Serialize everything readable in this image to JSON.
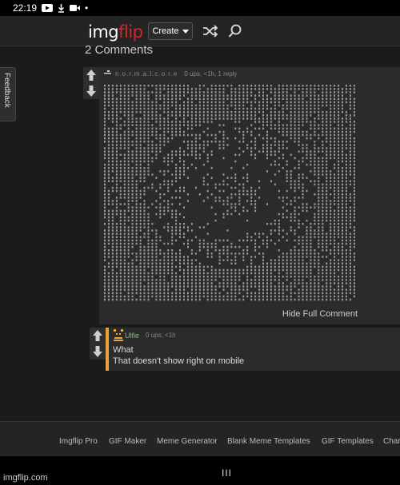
{
  "status_bar": {
    "time": "22:19",
    "dot": "•"
  },
  "header": {
    "logo_left": "img",
    "logo_right": "flip",
    "create_label": "Create",
    "accent_color": "#d5262d"
  },
  "comments": {
    "heading": "2 Comments",
    "feedback_label": "Feedback",
    "comment1": {
      "username": "n.o.r.m.a.l.c.o.r.e",
      "meta": "0 ups, <1h, 1 reply",
      "hide_label": "Hide Full Comment"
    },
    "comment2": {
      "username": "Ulfie",
      "meta": "0 ups, <1h",
      "line1": "What",
      "line2": "That doesn't show right on mobile",
      "accent_color": "#e8a33a",
      "username_color": "#7ec37e"
    }
  },
  "footer": {
    "links": [
      "Imgflip Pro",
      "GIF Maker",
      "Meme Generator",
      "Blank Meme Templates",
      "GIF Templates",
      "Char"
    ]
  },
  "system_nav": {
    "recents": "III"
  },
  "watermark": "imgflip.com"
}
